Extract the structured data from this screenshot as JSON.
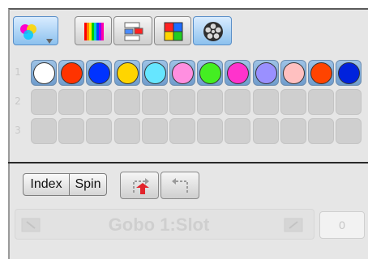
{
  "toolbar": {
    "color_mode_button": {
      "icon": "color-mixing-icon",
      "active": true
    },
    "tabs": [
      {
        "icon": "color-gradient-icon",
        "active": false
      },
      {
        "icon": "color-layout-icon",
        "active": false
      },
      {
        "icon": "color-quad-icon",
        "active": false
      },
      {
        "icon": "color-wheel-icon",
        "active": true
      }
    ]
  },
  "palette": {
    "rows": [
      {
        "label": "1",
        "colors": [
          "#ffffff",
          "#ff3300",
          "#0033ff",
          "#ffd500",
          "#66e6ff",
          "#ff8fe0",
          "#44ee22",
          "#ff33cc",
          "#9a90ff",
          "#ffc0c0",
          "#ff4400",
          "#0022dd"
        ]
      },
      {
        "label": "2",
        "colors": []
      },
      {
        "label": "3",
        "colors": []
      }
    ]
  },
  "mode": {
    "index_label": "Index",
    "spin_label": "Spin"
  },
  "gobo": {
    "slot_label": "Gobo 1:Slot",
    "value": "0"
  }
}
